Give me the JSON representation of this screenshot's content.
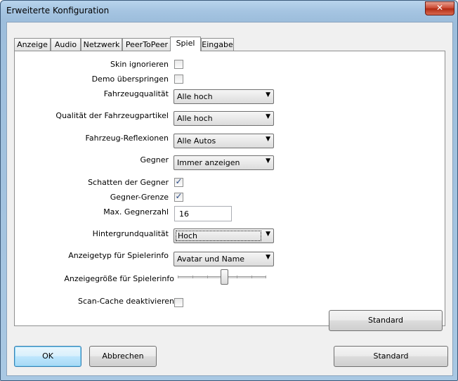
{
  "window": {
    "title": "Erweiterte Konfiguration",
    "close_glyph": "✕"
  },
  "tabs": [
    {
      "label": "Anzeige"
    },
    {
      "label": "Audio"
    },
    {
      "label": "Netzwerk"
    },
    {
      "label": "PeerToPeer"
    },
    {
      "label": "Spiel"
    },
    {
      "label": "Eingabe"
    }
  ],
  "active_tab": "Spiel",
  "settings": {
    "skin_ignorieren": {
      "label": "Skin ignorieren",
      "checked": false
    },
    "demo_ueberspringen": {
      "label": "Demo überspringen",
      "checked": false
    },
    "fahrzeugqualitaet": {
      "label": "Fahrzeugqualität",
      "value": "Alle hoch"
    },
    "fahrzeugpartikel": {
      "label": "Qualität der Fahrzeugpartikel",
      "value": "Alle hoch"
    },
    "fahrzeug_reflexionen": {
      "label": "Fahrzeug-Reflexionen",
      "value": "Alle Autos"
    },
    "gegner": {
      "label": "Gegner",
      "value": "Immer anzeigen"
    },
    "schatten_gegner": {
      "label": "Schatten der Gegner",
      "checked": true
    },
    "gegner_grenze": {
      "label": "Gegner-Grenze",
      "checked": true
    },
    "max_gegnerzahl": {
      "label": "Max. Gegnerzahl",
      "value": "16"
    },
    "hintergrundqualitaet": {
      "label": "Hintergrundqualität",
      "value": "Hoch"
    },
    "anzeigetyp_spielerinfo": {
      "label": "Anzeigetyp für Spielerinfo",
      "value": "Avatar und Name"
    },
    "anzeigegroesse_spielerinfo": {
      "label": "Anzeigegröße für Spielerinfo",
      "level_fraction": 0.5
    },
    "scan_cache": {
      "label": "Scan-Cache deaktivieren",
      "checked": false
    }
  },
  "glyphs": {
    "check": "✓",
    "dropdown_arrow": "▼"
  },
  "buttons": {
    "tab_standard": "Standard",
    "ok": "OK",
    "abbrechen": "Abbrechen",
    "standard": "Standard"
  }
}
